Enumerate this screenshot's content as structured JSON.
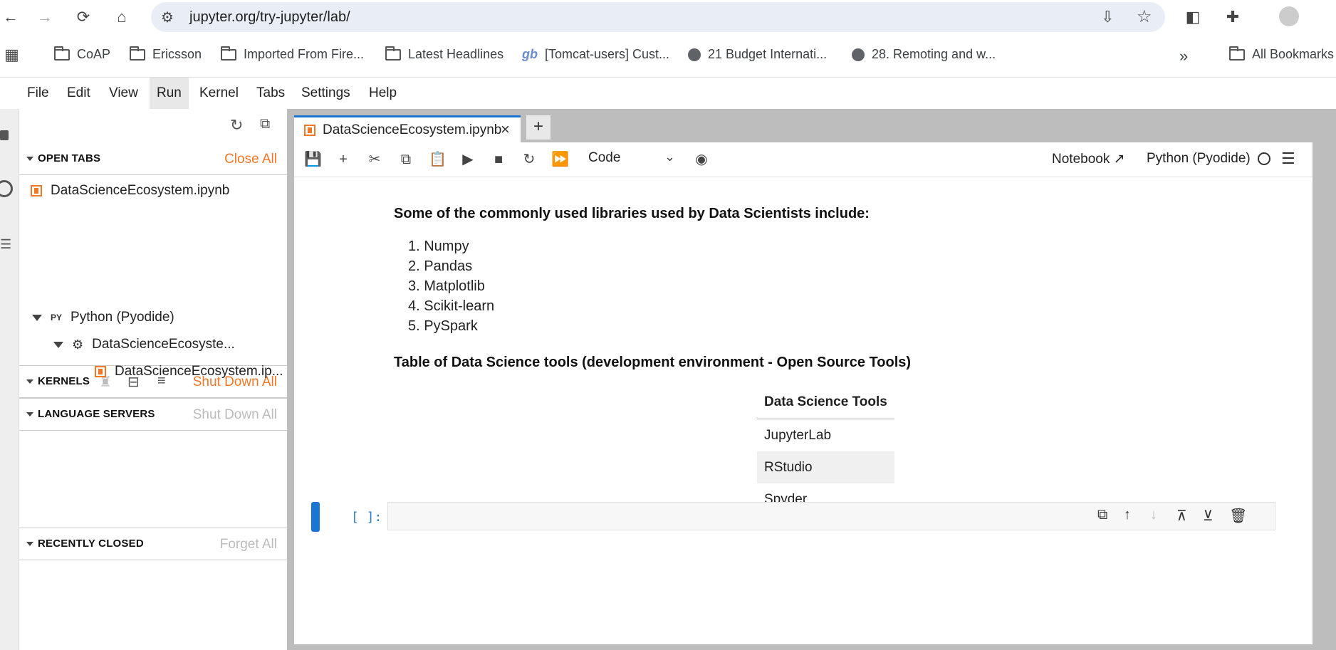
{
  "browser": {
    "url": "jupyter.org/try-jupyter/lab/",
    "bookmarks": [
      "CoAP",
      "Ericsson",
      "Imported From Fire...",
      "Latest Headlines",
      "[Tomcat-users] Cust...",
      "21 Budget Internati...",
      "28. Remoting and w..."
    ],
    "all_bookmarks": "All Bookmarks",
    "more": "»"
  },
  "menu": [
    "File",
    "Edit",
    "View",
    "Run",
    "Kernel",
    "Tabs",
    "Settings",
    "Help"
  ],
  "sidebar": {
    "open_tabs": {
      "title": "OPEN TABS",
      "action": "Close All",
      "items": [
        "DataScienceEcosystem.ipynb"
      ]
    },
    "kernels": {
      "title": "KERNELS",
      "action": "Shut Down All",
      "kernel": "Python (Pyodide)",
      "session": "DataScienceEcosyste...",
      "notebook": "DataScienceEcosystem.ip..."
    },
    "language_servers": {
      "title": "LANGUAGE SERVERS",
      "action": "Shut Down All"
    },
    "recently_closed": {
      "title": "RECENTLY CLOSED",
      "action": "Forget All"
    }
  },
  "tab": {
    "label": "DataScienceEcosystem.ipynb",
    "close": "×",
    "new": "+"
  },
  "toolbar": {
    "cell_type": "Code",
    "notebook_label": "Notebook",
    "kernel": "Python (Pyodide)"
  },
  "content": {
    "libraries_heading": "Some of the commonly used libraries used by Data Scientists include:",
    "libraries": [
      "1. Numpy",
      "2. Pandas",
      "3. Matplotlib",
      "4. Scikit-learn",
      "5. PySpark"
    ],
    "table_heading": "Table of Data Science tools (development environment - Open Source Tools)",
    "table_header": "Data Science Tools",
    "table_rows": [
      "JupyterLab",
      "RStudio",
      "Spyder"
    ],
    "prompt": "[ ]:"
  }
}
